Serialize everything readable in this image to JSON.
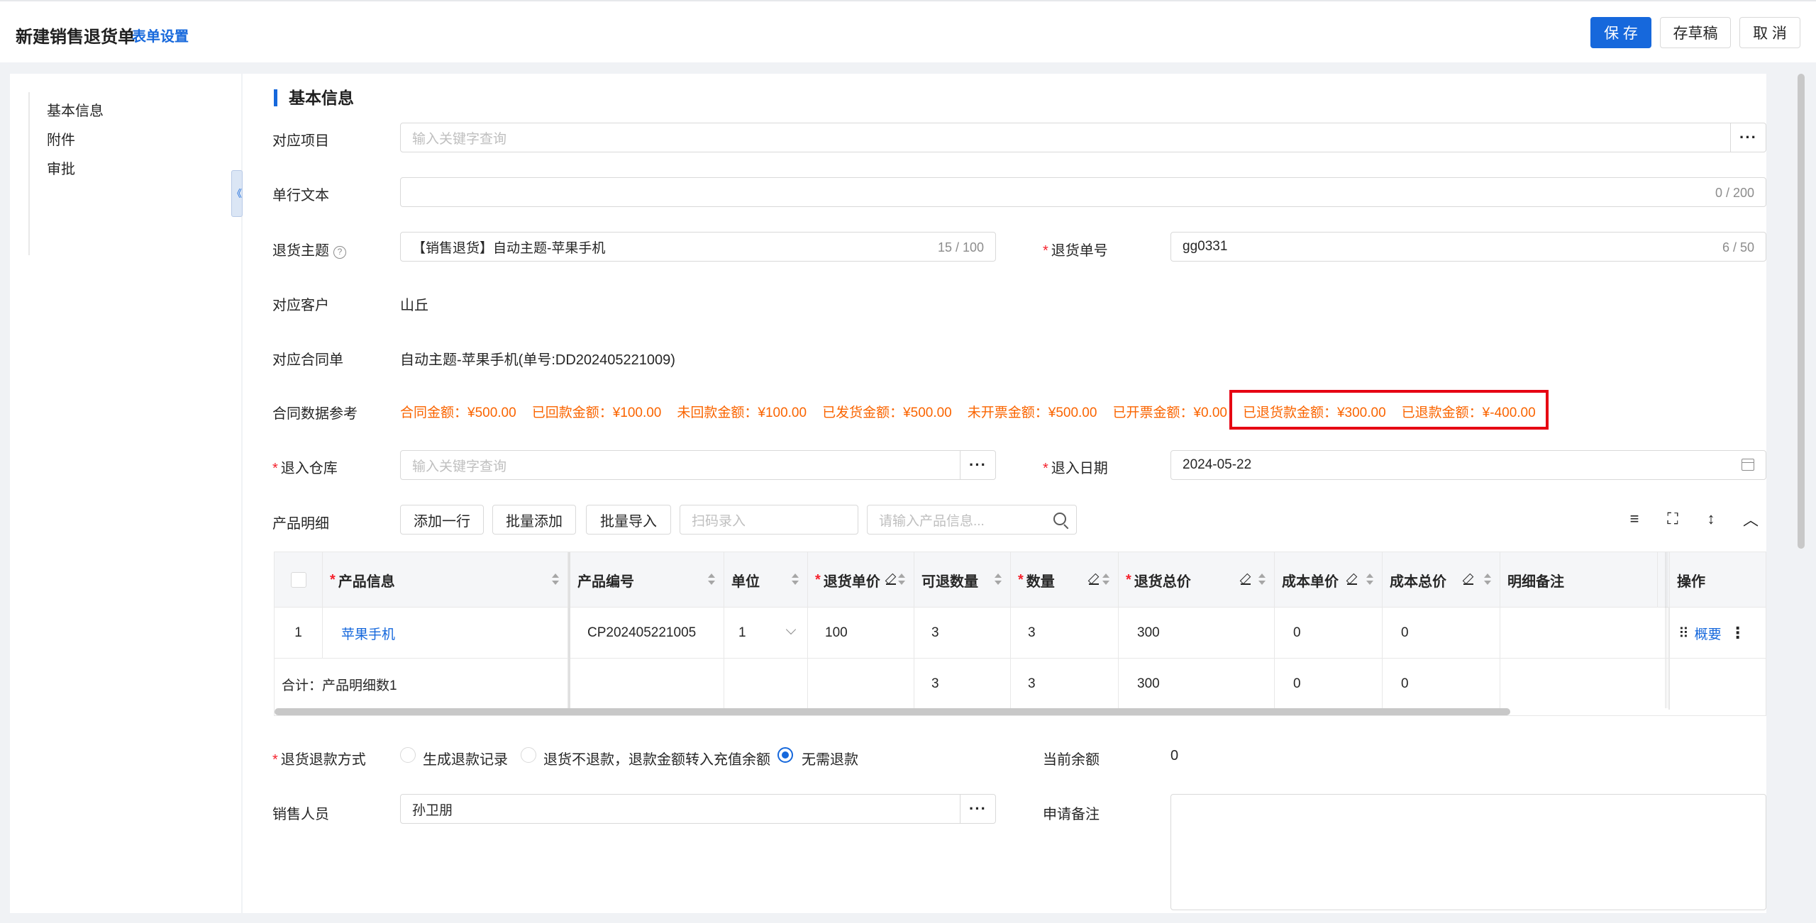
{
  "header": {
    "title": "新建销售退货单",
    "form_setting": "表单设置",
    "save_label": "保 存",
    "draft_label": "存草稿",
    "cancel_label": "取 消"
  },
  "sidebar": {
    "items": [
      {
        "label": "基本信息"
      },
      {
        "label": "附件"
      },
      {
        "label": "审批"
      }
    ],
    "collapse_glyph": "《"
  },
  "section": {
    "title": "基本信息"
  },
  "form": {
    "project": {
      "label": "对应项目",
      "placeholder": "输入关键字查询",
      "dots": "···"
    },
    "single_text": {
      "label": "单行文本",
      "count": "0 / 200"
    },
    "subject": {
      "label": "退货主题",
      "help": "?",
      "value": "【销售退货】自动主题-苹果手机",
      "count": "15 / 100"
    },
    "return_no": {
      "label": "退货单号",
      "value": "gg0331",
      "count": "6 / 50"
    },
    "customer": {
      "label": "对应客户",
      "value": "山丘"
    },
    "contract": {
      "label": "对应合同单",
      "value": "自动主题-苹果手机(单号:DD202405221009)"
    },
    "contract_ref": {
      "label": "合同数据参考",
      "items": [
        "合同金额：¥500.00",
        "已回款金额：¥100.00",
        "未回款金额：¥100.00",
        "已发货金额：¥500.00",
        "未开票金额：¥500.00",
        "已开票金额：¥0.00",
        "已退货款金额：¥300.00",
        "已退款金额：¥-400.00"
      ]
    },
    "warehouse": {
      "label": "退入仓库",
      "placeholder": "输入关键字查询",
      "dots": "···"
    },
    "return_date": {
      "label": "退入日期",
      "value": "2024-05-22"
    },
    "required_mark": "*"
  },
  "products": {
    "label": "产品明细",
    "add_row": "添加一行",
    "batch_add": "批量添加",
    "batch_import": "批量导入",
    "scan_placeholder": "扫码录入",
    "search_placeholder": "请输入产品信息...",
    "tool_icons": {
      "density": "≡",
      "fullscreen": "⛶",
      "height": "↕",
      "collapse": "︿"
    }
  },
  "table": {
    "headers": {
      "product_info": "产品信息",
      "product_code": "产品编号",
      "unit": "单位",
      "unit_price": "退货单价",
      "returnable_qty": "可退数量",
      "qty": "数量",
      "total_price": "退货总价",
      "cost_price": "成本单价",
      "cost_total": "成本总价",
      "note": "明细备注",
      "action": "操作"
    },
    "rows": [
      {
        "index": "1",
        "product_info": "苹果手机",
        "product_code": "CP202405221005",
        "unit": "1",
        "unit_price": "100",
        "returnable_qty": "3",
        "qty": "3",
        "total_price": "300",
        "cost_price": "0",
        "cost_total": "0",
        "drag": "⠿",
        "overview": "概要",
        "more": "⋮"
      }
    ],
    "summary": {
      "label": "合计：产品明细数1",
      "returnable_qty": "3",
      "qty": "3",
      "total_price": "300",
      "cost_price": "0",
      "cost_total": "0"
    }
  },
  "refund": {
    "label": "退货退款方式",
    "options": [
      "生成退款记录",
      "退货不退款，退款金额转入充值余额",
      "无需退款"
    ],
    "selected_index": 2,
    "balance_label": "当前余额",
    "balance_value": "0"
  },
  "sales": {
    "label": "销售人员",
    "value": "孙卫朋",
    "dots": "···"
  },
  "remark": {
    "label": "申请备注"
  }
}
